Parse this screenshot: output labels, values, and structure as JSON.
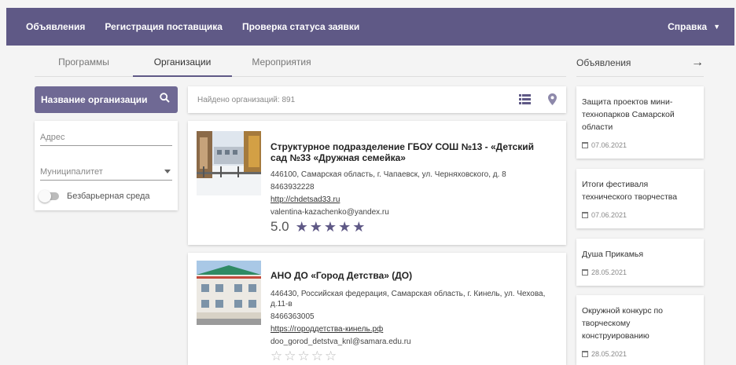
{
  "topnav": {
    "items": [
      "Объявления",
      "Регистрация поставщика",
      "Проверка статуса заявки"
    ],
    "help": "Справка"
  },
  "tabs": [
    "Программы",
    "Организации",
    "Мероприятия"
  ],
  "announcements_header": "Объявления",
  "search": {
    "label": "Название организации"
  },
  "filters": {
    "address_placeholder": "Адрес",
    "municipality_placeholder": "Муниципалитет",
    "barrier_free_label": "Безбарьерная среда"
  },
  "results": {
    "found_text": "Найдено организаций: 891"
  },
  "organizations": [
    {
      "name": "Структурное подразделение ГБОУ СОШ №13 - «Детский сад №33 «Дружная семейка»",
      "address": "446100, Самарская область, г. Чапаевск, ул. Черняховского, д. 8",
      "phone": "8463932228",
      "website": "http://chdetsad33.ru",
      "email": "valentina-kazachenko@yandex.ru",
      "rating_text": "5.0",
      "rating": 5
    },
    {
      "name": "АНО ДО «Город Детства» (ДО)",
      "address": "446430, Российская федерация, Самарская область, г. Кинель, ул. Чехова, д.11-в",
      "phone": "8466363005",
      "website": "https://городдетства-кинель.рф",
      "email": "doo_gorod_detstva_knl@samara.edu.ru",
      "rating": 0
    }
  ],
  "announcements": [
    {
      "title": "Защита проектов мини-технопарков Самарской области",
      "date": "07.06.2021"
    },
    {
      "title": "Итоги фестиваля технического творчества",
      "date": "07.06.2021"
    },
    {
      "title": "Душа Прикамья",
      "date": "28.05.2021"
    },
    {
      "title": "Окружной конкурс по творческому конструированию",
      "date": "28.05.2021"
    }
  ],
  "colors": {
    "brand": "#5f5986",
    "search_bg": "#6f6994",
    "star": "#5f5986"
  }
}
